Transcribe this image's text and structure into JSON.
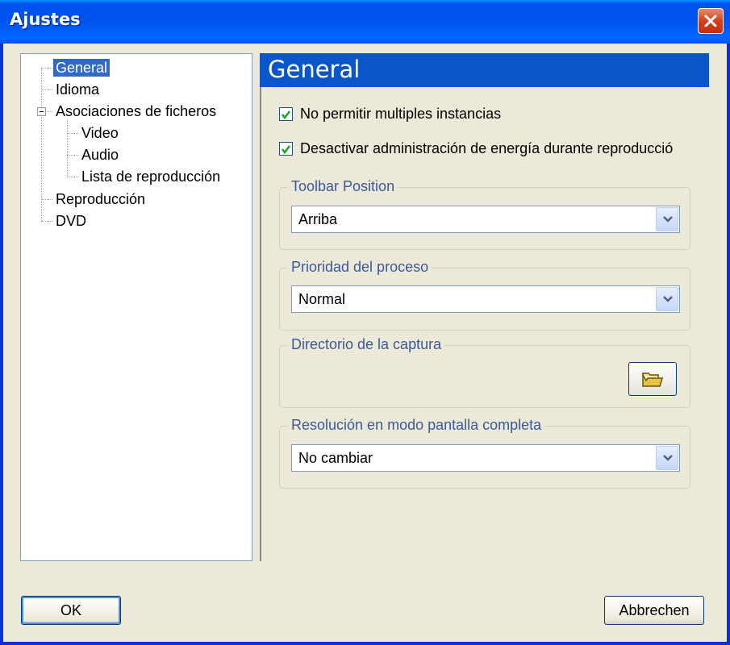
{
  "window": {
    "title": "Ajustes"
  },
  "tree": {
    "items": [
      {
        "label": "General",
        "selected": true
      },
      {
        "label": "Idioma"
      },
      {
        "label": "Asociaciones de ficheros",
        "expanded": true
      },
      {
        "label": "Video"
      },
      {
        "label": "Audio"
      },
      {
        "label": "Lista de reproducción"
      },
      {
        "label": "Reproducción"
      },
      {
        "label": "DVD"
      }
    ]
  },
  "panel": {
    "title": "General",
    "checkboxes": [
      {
        "label": "No permitir multiples instancias",
        "checked": true
      },
      {
        "label": "Desactivar administración de energía durante reproducció",
        "checked": true
      }
    ],
    "toolbar_position": {
      "label": "Toolbar Position",
      "value": "Arriba"
    },
    "process_priority": {
      "label": "Prioridad del proceso",
      "value": "Normal"
    },
    "capture_directory": {
      "label": "Directorio de la captura",
      "button_icon": "folder-icon"
    },
    "fullscreen_resolution": {
      "label": "Resolución en modo pantalla completa",
      "value": "No cambiar"
    }
  },
  "buttons": {
    "ok": "OK",
    "cancel": "Abbrechen"
  },
  "colors": {
    "titlebar": "#0054e3",
    "selection": "#316ac5",
    "panel_header": "#0a56c8",
    "check": "#21a121"
  }
}
